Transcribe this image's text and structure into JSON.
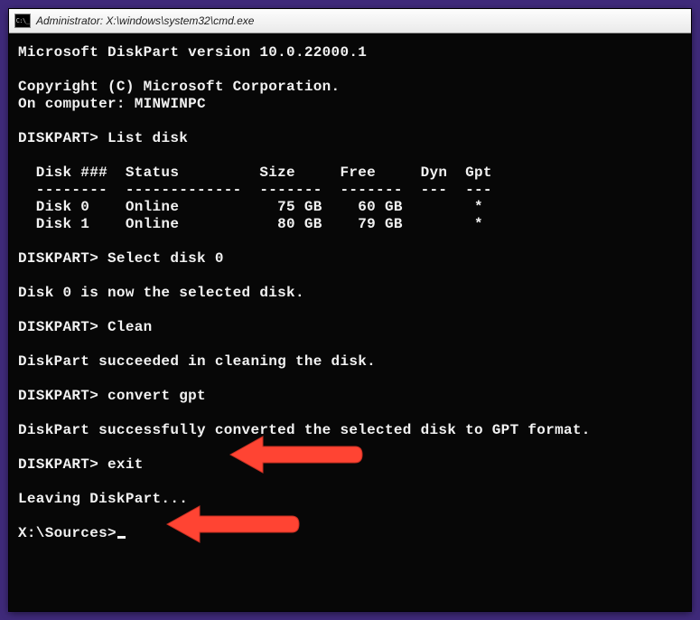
{
  "window": {
    "title": "Administrator: X:\\windows\\system32\\cmd.exe"
  },
  "terminal": {
    "version_line": "Microsoft DiskPart version 10.0.22000.1",
    "copyright": "Copyright (C) Microsoft Corporation.",
    "computer": "On computer: MINWINPC",
    "prompt": "DISKPART>",
    "cmd_list": "List disk",
    "table": {
      "header": "  Disk ###  Status         Size     Free     Dyn  Gpt",
      "divider": "  --------  -------------  -------  -------  ---  ---",
      "rows": [
        "  Disk 0    Online           75 GB    60 GB        *",
        "  Disk 1    Online           80 GB    79 GB        *"
      ]
    },
    "cmd_select": "Select disk 0",
    "resp_select": "Disk 0 is now the selected disk.",
    "cmd_clean": "Clean",
    "resp_clean": "DiskPart succeeded in cleaning the disk.",
    "cmd_convert": "convert gpt",
    "resp_convert": "DiskPart successfully converted the selected disk to GPT format.",
    "cmd_exit": "exit",
    "resp_exit": "Leaving DiskPart...",
    "final_prompt": "X:\\Sources>"
  },
  "annotations": {
    "arrow1_target": "convert gpt",
    "arrow2_target": "exit",
    "color": "#ff4433"
  }
}
